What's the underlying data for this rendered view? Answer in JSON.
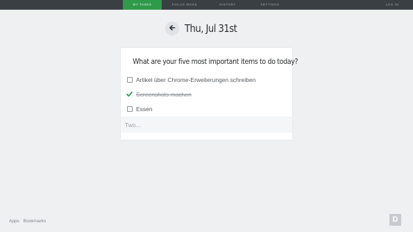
{
  "nav": {
    "items": [
      {
        "label": "MY TASKS",
        "active": true
      },
      {
        "label": "FOCUS MODE",
        "active": false
      },
      {
        "label": "HISTORY",
        "active": false
      },
      {
        "label": "SETTINGS",
        "active": false
      }
    ],
    "login_label": "LOG IN",
    "active_color": "#2f9a4a"
  },
  "header": {
    "date": "Thu, Jul 31st",
    "back_icon": "arrow-left-icon"
  },
  "card": {
    "title": "What are your five most important items to do today?",
    "tasks": [
      {
        "text": "Artikel über Chrome-Erweiterungen schreiben",
        "done": false
      },
      {
        "text": "Screenshots machen",
        "done": true
      },
      {
        "text": "Essen",
        "done": false
      }
    ],
    "new_task_placeholder": "Two..."
  },
  "footer": {
    "links": [
      "Apps",
      "Bookmarks"
    ],
    "badge": "D"
  }
}
